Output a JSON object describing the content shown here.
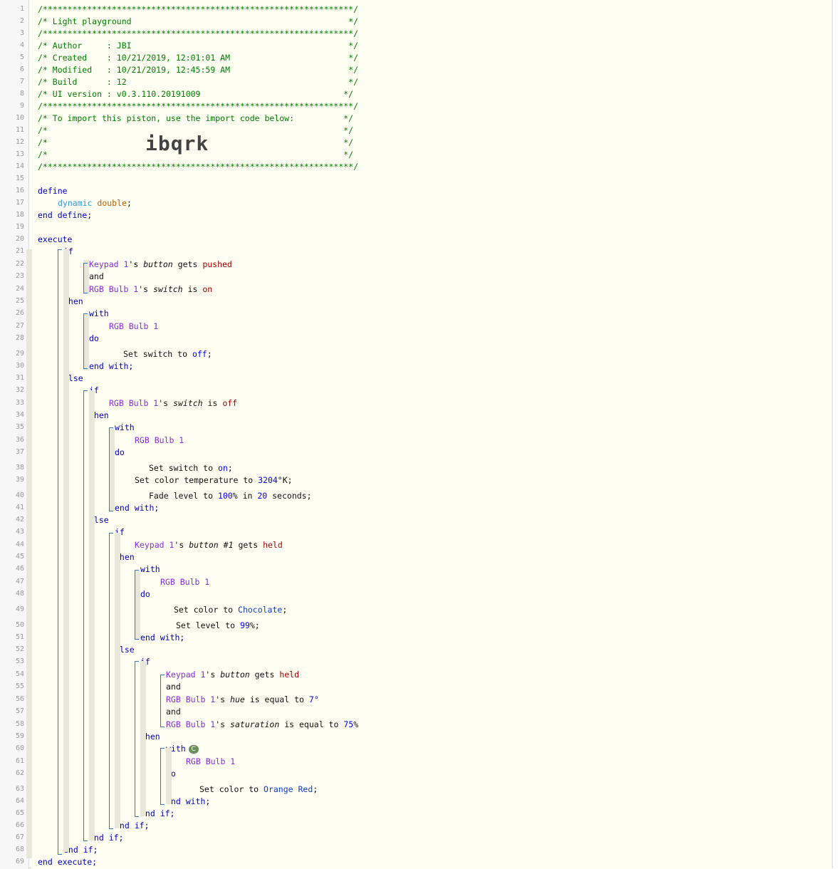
{
  "line_numbers": [
    "1",
    "2",
    "3",
    "4",
    "5",
    "6",
    "7",
    "8",
    "9",
    "10",
    "11",
    "12",
    "13",
    "14",
    "15",
    "16",
    "17",
    "18",
    "19",
    "20",
    "21",
    "22",
    "23",
    "24",
    "25",
    "26",
    "27",
    "28",
    "29",
    "30",
    "31",
    "32",
    "33",
    "34",
    "35",
    "36",
    "37",
    "38",
    "39",
    "40",
    "41",
    "42",
    "43",
    "44",
    "45",
    "46",
    "47",
    "48",
    "49",
    "50",
    "51",
    "52",
    "53",
    "54",
    "55",
    "56",
    "57",
    "58",
    "59",
    "60",
    "61",
    "62",
    "63",
    "64",
    "65",
    "66",
    "67",
    "68",
    "69"
  ],
  "header": {
    "stars": "/***************************************************************/",
    "title": "/* Light playground                                            */",
    "author": "/* Author     : JBI                                            */",
    "created": "/* Created    : 10/21/2019, 12:01:01 AM                        */",
    "modified": "/* Modified   : 10/21/2019, 12:45:59 AM                        */",
    "build": "/* Build      : 12                                             */",
    "ui_version": "/* UI version : v0.3.110.20191009                             */",
    "import_note": "/* To import this piston, use the import code below:          */",
    "blank": "/*                                                            */",
    "import_code": "ibqrk"
  },
  "kw": {
    "define": "define",
    "end_define": "end define;",
    "execute": "execute",
    "end_execute": "end execute;",
    "if": "if",
    "and": "and",
    "then": "then",
    "else": "else",
    "with": "with",
    "do": "do",
    "end_with": "end with;",
    "end_if": "end if;"
  },
  "vars": {
    "name": "dynamic",
    "type": "double"
  },
  "devices": {
    "keypad": "Keypad 1",
    "bulb": "RGB Bulb 1"
  },
  "text": {
    "poss": "'s",
    "button": "button",
    "button1": "button #1",
    "switch": "switch",
    "hue": "hue",
    "saturation": "saturation",
    "gets": "gets",
    "is": "is",
    "is_equal_to": "is equal to",
    "pushed": "pushed",
    "held": "held",
    "on": "on",
    "off": "off",
    "set_switch_to": "Set switch to ",
    "set_color_temp_to": "Set color temperature to ",
    "kelvin": "°K;",
    "fade_level_to": "Fade level to ",
    "pct_in": "% in ",
    "seconds": " seconds;",
    "set_color_to": "Set color to ",
    "set_level_to": "Set level to ",
    "pct_semicolon": "%;",
    "semicolon": ";",
    "degree": "°",
    "percent": "%",
    "badge": "C"
  },
  "values": {
    "color_temp": "3204",
    "fade_level": "100",
    "fade_seconds": "20",
    "chocolate": "Chocolate",
    "level": "99",
    "hue": "7",
    "saturation": "75",
    "orange_red": "Orange Red"
  }
}
